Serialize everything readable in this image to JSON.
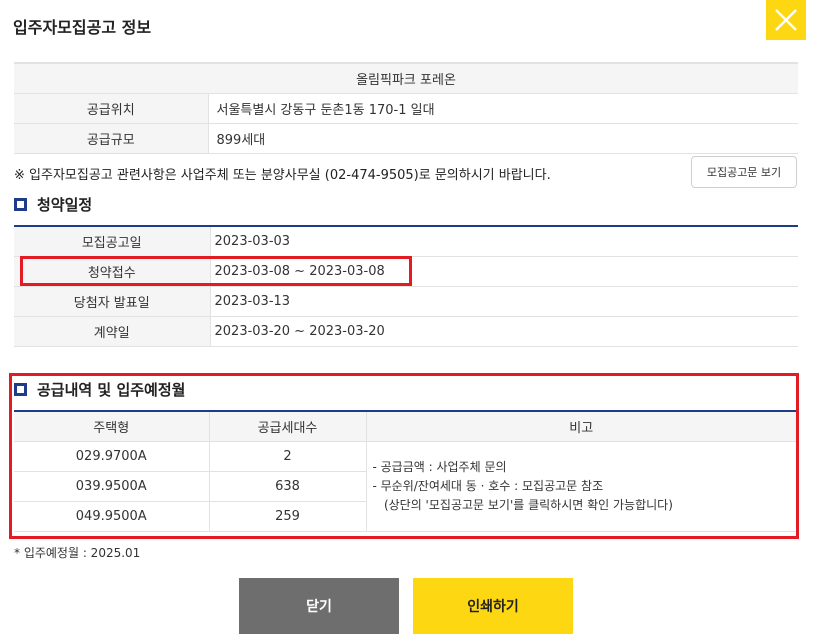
{
  "dialog": {
    "title": "입주자모집공고 정보",
    "close_icon": "close-x-icon",
    "accent_color": "#fdd712"
  },
  "info": {
    "complex_name": "올림픽파크 포레온",
    "rows": [
      {
        "label": "공급위치",
        "value": "서울특별시 강동구 둔촌1동 170-1 일대"
      },
      {
        "label": "공급규모",
        "value": "899세대"
      }
    ],
    "notice": "※ 입주자모집공고 관련사항은 사업주체 또는 분양사무실 (02-474-9505)로 문의하시기 바랍니다.",
    "doc_button": "모집공고문 보기"
  },
  "schedule": {
    "title": "청약일정",
    "rows": [
      {
        "label": "모집공고일",
        "value": "2023-03-03"
      },
      {
        "label": "청약접수",
        "value": "2023-03-08 ~ 2023-03-08"
      },
      {
        "label": "당첨자 발표일",
        "value": "2023-03-13"
      },
      {
        "label": "계약일",
        "value": "2023-03-20 ~ 2023-03-20"
      }
    ]
  },
  "supply": {
    "title": "공급내역 및 입주예정월",
    "headers": [
      "주택형",
      "공급세대수",
      "비고"
    ],
    "rows": [
      {
        "type": "029.9700A",
        "units": "2"
      },
      {
        "type": "039.9500A",
        "units": "638"
      },
      {
        "type": "049.9500A",
        "units": "259"
      }
    ],
    "remarks": [
      "-  공급금액 : 사업주체 문의",
      "-  무순위/잔여세대 동 · 호수 : 모집공고문 참조",
      "   (상단의 '모집공고문 보기'를 클릭하시면 확인 가능합니다)"
    ],
    "move_in": "* 입주예정월 : 2025.01"
  },
  "buttons": {
    "close": "닫기",
    "print": "인쇄하기"
  },
  "colors": {
    "primary": "#1f3c88",
    "highlight": "#e31b23",
    "close_button": "#6e6e6e",
    "print_button": "#fdd712"
  }
}
